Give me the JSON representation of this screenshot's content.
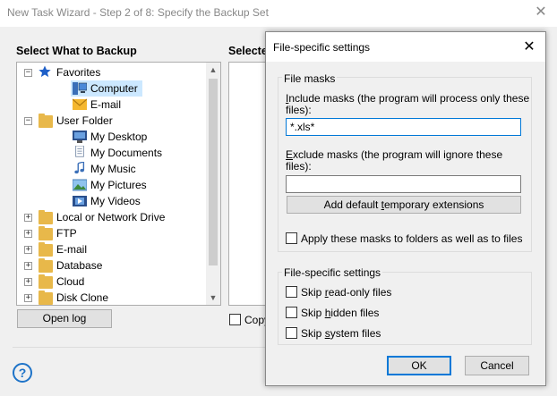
{
  "window": {
    "title": "New Task Wizard - Step 2 of 8: Specify the Backup Set",
    "close_glyph": "✕"
  },
  "left": {
    "heading": "Select What to Backup",
    "tree": [
      {
        "label": "Favorites",
        "icon": "star-icon",
        "expander": "−"
      },
      {
        "label": "Computer",
        "icon": "computer-icon"
      },
      {
        "label": "E-mail",
        "icon": "envelope-icon"
      },
      {
        "label": "User Folder",
        "icon": "folder-icon",
        "expander": "−"
      },
      {
        "label": "My Desktop",
        "icon": "desktop-icon"
      },
      {
        "label": "My Documents",
        "icon": "documents-icon"
      },
      {
        "label": "My Music",
        "icon": "music-icon"
      },
      {
        "label": "My Pictures",
        "icon": "pictures-icon"
      },
      {
        "label": "My Videos",
        "icon": "videos-icon"
      },
      {
        "label": "Local or Network Drive",
        "icon": "folder-icon",
        "expander": "+"
      },
      {
        "label": "FTP",
        "icon": "folder-icon",
        "expander": "+"
      },
      {
        "label": "E-mail",
        "icon": "folder-icon",
        "expander": "+"
      },
      {
        "label": "Database",
        "icon": "folder-icon",
        "expander": "+"
      },
      {
        "label": "Cloud",
        "icon": "folder-icon",
        "expander": "+"
      },
      {
        "label": "Disk Clone",
        "icon": "folder-icon",
        "expander": "+"
      }
    ],
    "open_log_label": "Open log"
  },
  "right": {
    "heading_partial": "Selecte",
    "copy_partial": "Copy"
  },
  "help_glyph": "?",
  "dialog": {
    "title": "File-specific settings",
    "close_glyph": "✕",
    "file_masks": {
      "label": "File masks",
      "include_label_1_ul": "I",
      "include_label_1_rest": "nclude masks (the program will process only these",
      "include_label_2": "files):",
      "include_value": "*.xls*",
      "exclude_label_1_ul": "E",
      "exclude_label_1_rest": "xclude masks (the program will ignore these",
      "exclude_label_2": "files):",
      "exclude_value": "",
      "add_default_pre": "Add default ",
      "add_default_ul": "t",
      "add_default_post": "emporary extensions",
      "apply_folders_label": "Apply these masks to folders as well as to files",
      "apply_folders_checked": false
    },
    "settings": {
      "label": "File-specific settings",
      "skip_readonly_pre": "Skip ",
      "skip_readonly_ul": "r",
      "skip_readonly_post": "ead-only files",
      "skip_hidden_pre": "Skip ",
      "skip_hidden_ul": "h",
      "skip_hidden_post": "idden files",
      "skip_system_pre": "Skip ",
      "skip_system_ul": "s",
      "skip_system_post": "ystem files"
    },
    "ok_label": "OK",
    "cancel_label": "Cancel"
  },
  "colors": {
    "accent": "#0078d7",
    "folder": "#e8b84a",
    "help": "#1e73c8"
  }
}
